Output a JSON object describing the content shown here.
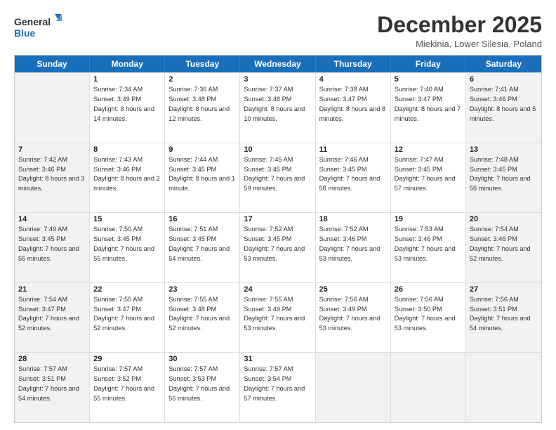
{
  "logo": {
    "text_general": "General",
    "text_blue": "Blue"
  },
  "header": {
    "month": "December 2025",
    "location": "Miekinia, Lower Silesia, Poland"
  },
  "days": [
    "Sunday",
    "Monday",
    "Tuesday",
    "Wednesday",
    "Thursday",
    "Friday",
    "Saturday"
  ],
  "weeks": [
    [
      {
        "day": "",
        "shade": true,
        "sunrise": "",
        "sunset": "",
        "daylight": ""
      },
      {
        "day": "1",
        "shade": false,
        "sunrise": "Sunrise: 7:34 AM",
        "sunset": "Sunset: 3:49 PM",
        "daylight": "Daylight: 8 hours and 14 minutes."
      },
      {
        "day": "2",
        "shade": false,
        "sunrise": "Sunrise: 7:36 AM",
        "sunset": "Sunset: 3:48 PM",
        "daylight": "Daylight: 8 hours and 12 minutes."
      },
      {
        "day": "3",
        "shade": false,
        "sunrise": "Sunrise: 7:37 AM",
        "sunset": "Sunset: 3:48 PM",
        "daylight": "Daylight: 8 hours and 10 minutes."
      },
      {
        "day": "4",
        "shade": false,
        "sunrise": "Sunrise: 7:38 AM",
        "sunset": "Sunset: 3:47 PM",
        "daylight": "Daylight: 8 hours and 8 minutes."
      },
      {
        "day": "5",
        "shade": false,
        "sunrise": "Sunrise: 7:40 AM",
        "sunset": "Sunset: 3:47 PM",
        "daylight": "Daylight: 8 hours and 7 minutes."
      },
      {
        "day": "6",
        "shade": true,
        "sunrise": "Sunrise: 7:41 AM",
        "sunset": "Sunset: 3:46 PM",
        "daylight": "Daylight: 8 hours and 5 minutes."
      }
    ],
    [
      {
        "day": "7",
        "shade": true,
        "sunrise": "Sunrise: 7:42 AM",
        "sunset": "Sunset: 3:46 PM",
        "daylight": "Daylight: 8 hours and 3 minutes."
      },
      {
        "day": "8",
        "shade": false,
        "sunrise": "Sunrise: 7:43 AM",
        "sunset": "Sunset: 3:46 PM",
        "daylight": "Daylight: 8 hours and 2 minutes."
      },
      {
        "day": "9",
        "shade": false,
        "sunrise": "Sunrise: 7:44 AM",
        "sunset": "Sunset: 3:45 PM",
        "daylight": "Daylight: 8 hours and 1 minute."
      },
      {
        "day": "10",
        "shade": false,
        "sunrise": "Sunrise: 7:45 AM",
        "sunset": "Sunset: 3:45 PM",
        "daylight": "Daylight: 7 hours and 59 minutes."
      },
      {
        "day": "11",
        "shade": false,
        "sunrise": "Sunrise: 7:46 AM",
        "sunset": "Sunset: 3:45 PM",
        "daylight": "Daylight: 7 hours and 58 minutes."
      },
      {
        "day": "12",
        "shade": false,
        "sunrise": "Sunrise: 7:47 AM",
        "sunset": "Sunset: 3:45 PM",
        "daylight": "Daylight: 7 hours and 57 minutes."
      },
      {
        "day": "13",
        "shade": true,
        "sunrise": "Sunrise: 7:48 AM",
        "sunset": "Sunset: 3:45 PM",
        "daylight": "Daylight: 7 hours and 56 minutes."
      }
    ],
    [
      {
        "day": "14",
        "shade": true,
        "sunrise": "Sunrise: 7:49 AM",
        "sunset": "Sunset: 3:45 PM",
        "daylight": "Daylight: 7 hours and 55 minutes."
      },
      {
        "day": "15",
        "shade": false,
        "sunrise": "Sunrise: 7:50 AM",
        "sunset": "Sunset: 3:45 PM",
        "daylight": "Daylight: 7 hours and 55 minutes."
      },
      {
        "day": "16",
        "shade": false,
        "sunrise": "Sunrise: 7:51 AM",
        "sunset": "Sunset: 3:45 PM",
        "daylight": "Daylight: 7 hours and 54 minutes."
      },
      {
        "day": "17",
        "shade": false,
        "sunrise": "Sunrise: 7:52 AM",
        "sunset": "Sunset: 3:45 PM",
        "daylight": "Daylight: 7 hours and 53 minutes."
      },
      {
        "day": "18",
        "shade": false,
        "sunrise": "Sunrise: 7:52 AM",
        "sunset": "Sunset: 3:46 PM",
        "daylight": "Daylight: 7 hours and 53 minutes."
      },
      {
        "day": "19",
        "shade": false,
        "sunrise": "Sunrise: 7:53 AM",
        "sunset": "Sunset: 3:46 PM",
        "daylight": "Daylight: 7 hours and 53 minutes."
      },
      {
        "day": "20",
        "shade": true,
        "sunrise": "Sunrise: 7:54 AM",
        "sunset": "Sunset: 3:46 PM",
        "daylight": "Daylight: 7 hours and 52 minutes."
      }
    ],
    [
      {
        "day": "21",
        "shade": true,
        "sunrise": "Sunrise: 7:54 AM",
        "sunset": "Sunset: 3:47 PM",
        "daylight": "Daylight: 7 hours and 52 minutes."
      },
      {
        "day": "22",
        "shade": false,
        "sunrise": "Sunrise: 7:55 AM",
        "sunset": "Sunset: 3:47 PM",
        "daylight": "Daylight: 7 hours and 52 minutes."
      },
      {
        "day": "23",
        "shade": false,
        "sunrise": "Sunrise: 7:55 AM",
        "sunset": "Sunset: 3:48 PM",
        "daylight": "Daylight: 7 hours and 52 minutes."
      },
      {
        "day": "24",
        "shade": false,
        "sunrise": "Sunrise: 7:55 AM",
        "sunset": "Sunset: 3:49 PM",
        "daylight": "Daylight: 7 hours and 53 minutes."
      },
      {
        "day": "25",
        "shade": false,
        "sunrise": "Sunrise: 7:56 AM",
        "sunset": "Sunset: 3:49 PM",
        "daylight": "Daylight: 7 hours and 53 minutes."
      },
      {
        "day": "26",
        "shade": false,
        "sunrise": "Sunrise: 7:56 AM",
        "sunset": "Sunset: 3:50 PM",
        "daylight": "Daylight: 7 hours and 53 minutes."
      },
      {
        "day": "27",
        "shade": true,
        "sunrise": "Sunrise: 7:56 AM",
        "sunset": "Sunset: 3:51 PM",
        "daylight": "Daylight: 7 hours and 54 minutes."
      }
    ],
    [
      {
        "day": "28",
        "shade": true,
        "sunrise": "Sunrise: 7:57 AM",
        "sunset": "Sunset: 3:51 PM",
        "daylight": "Daylight: 7 hours and 54 minutes."
      },
      {
        "day": "29",
        "shade": false,
        "sunrise": "Sunrise: 7:57 AM",
        "sunset": "Sunset: 3:52 PM",
        "daylight": "Daylight: 7 hours and 55 minutes."
      },
      {
        "day": "30",
        "shade": false,
        "sunrise": "Sunrise: 7:57 AM",
        "sunset": "Sunset: 3:53 PM",
        "daylight": "Daylight: 7 hours and 56 minutes."
      },
      {
        "day": "31",
        "shade": false,
        "sunrise": "Sunrise: 7:57 AM",
        "sunset": "Sunset: 3:54 PM",
        "daylight": "Daylight: 7 hours and 57 minutes."
      },
      {
        "day": "",
        "shade": true,
        "sunrise": "",
        "sunset": "",
        "daylight": ""
      },
      {
        "day": "",
        "shade": true,
        "sunrise": "",
        "sunset": "",
        "daylight": ""
      },
      {
        "day": "",
        "shade": true,
        "sunrise": "",
        "sunset": "",
        "daylight": ""
      }
    ]
  ]
}
